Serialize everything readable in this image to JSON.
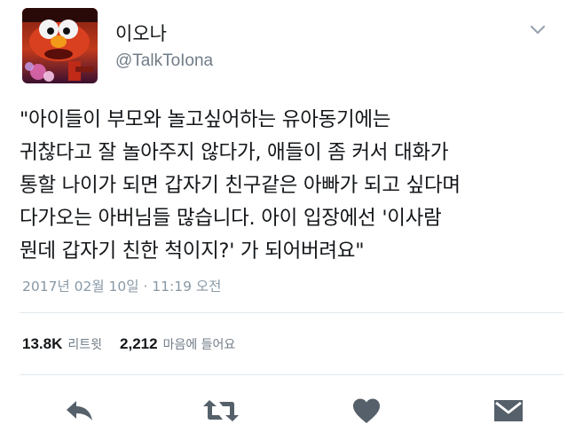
{
  "user": {
    "display_name": "이오나",
    "handle": "@TalkToIona",
    "avatar_icon": "avatar-image"
  },
  "tweet": {
    "lines": [
      "\"아이들이 부모와 놀고싶어하는 유아동기에는",
      "귀찮다고 잘 놀아주지 않다가, 애들이 좀 커서 대화가",
      "통할 나이가 되면 갑자기 친구같은 아빠가 되고 싶다며",
      "다가오는 아버님들 많습니다. 아이 입장에선 '이사람",
      "뭔데 갑자기 친한 척이지?' 가 되어버려요\""
    ],
    "timestamp": "2017년 02월 10일 · 11:19 오전"
  },
  "stats": {
    "retweets_count": "13.8K",
    "retweets_label": "리트윗",
    "likes_count": "2,212",
    "likes_label": "마음에 들어요"
  },
  "actions": {
    "reply_icon": "reply-icon",
    "retweet_icon": "retweet-icon",
    "like_icon": "heart-icon",
    "message_icon": "direct-message-icon"
  },
  "colors": {
    "text": "#14171a",
    "secondary": "#707c87",
    "timestamp": "#8899a6",
    "icon": "#55606a",
    "divider": "#e1e8ed"
  }
}
